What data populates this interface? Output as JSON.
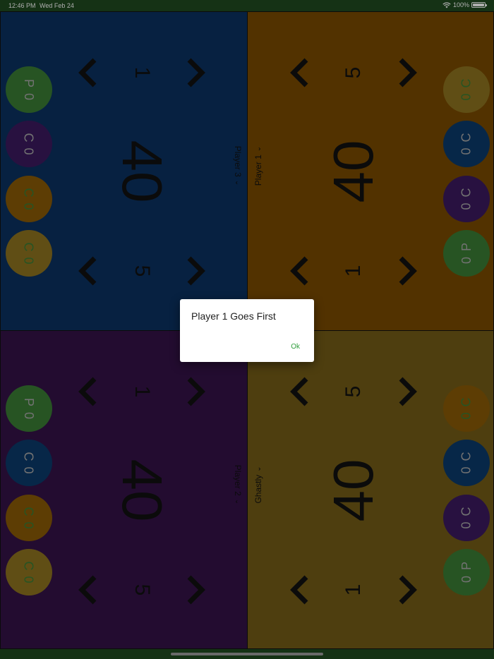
{
  "status_bar": {
    "time": "12:46 PM",
    "date": "Wed Feb 24",
    "battery": "100%"
  },
  "icons": {
    "chevron": "chevron-icon",
    "wifi": "wifi-icon",
    "battery": "battery-icon",
    "dropdown": "chevron-down-icon"
  },
  "quadrants": [
    {
      "id": "top-left",
      "color": "#0b3260",
      "player_name": "Player 3",
      "life": "40",
      "top_value": "1",
      "bottom_value": "5",
      "counters": [
        {
          "letter": "P",
          "value": "0",
          "color": "#3a7d34",
          "text_color": "#a8a8a8"
        },
        {
          "letter": "C",
          "value": "0",
          "color": "#3b1a5f",
          "text_color": "#a8a8a8"
        },
        {
          "letter": "C",
          "value": "0",
          "color": "#8a5a06",
          "text_color": "#3a7d34"
        },
        {
          "letter": "C",
          "value": "0",
          "color": "#8e7420",
          "text_color": "#3a7d34"
        }
      ]
    },
    {
      "id": "top-right",
      "color": "#7a4b00",
      "player_name": "Player 1",
      "life": "40",
      "top_value": "5",
      "bottom_value": "1",
      "counters": [
        {
          "letter": "C",
          "value": "0",
          "color": "#8e7420",
          "text_color": "#3a7d34"
        },
        {
          "letter": "C",
          "value": "0",
          "color": "#0b3a6a",
          "text_color": "#a8a8a8"
        },
        {
          "letter": "C",
          "value": "0",
          "color": "#3b1a5f",
          "text_color": "#a8a8a8"
        },
        {
          "letter": "P",
          "value": "0",
          "color": "#3a7d34",
          "text_color": "#a8a8a8"
        }
      ]
    },
    {
      "id": "bottom-left",
      "color": "#341248",
      "player_name": "Player 2",
      "life": "40",
      "top_value": "1",
      "bottom_value": "5",
      "counters": [
        {
          "letter": "P",
          "value": "0",
          "color": "#3a7d34",
          "text_color": "#a8a8a8"
        },
        {
          "letter": "C",
          "value": "0",
          "color": "#0b3a6a",
          "text_color": "#a8a8a8"
        },
        {
          "letter": "C",
          "value": "0",
          "color": "#8a5a06",
          "text_color": "#3a7d34"
        },
        {
          "letter": "C",
          "value": "0",
          "color": "#8e7420",
          "text_color": "#3a7d34"
        }
      ]
    },
    {
      "id": "bottom-right",
      "color": "#735c17",
      "player_name": "Ghastly",
      "life": "40",
      "top_value": "5",
      "bottom_value": "1",
      "counters": [
        {
          "letter": "C",
          "value": "0",
          "color": "#8a5a06",
          "text_color": "#3a7d34"
        },
        {
          "letter": "C",
          "value": "0",
          "color": "#0b3a6a",
          "text_color": "#a8a8a8"
        },
        {
          "letter": "C",
          "value": "0",
          "color": "#3b1a5f",
          "text_color": "#a8a8a8"
        },
        {
          "letter": "P",
          "value": "0",
          "color": "#3a7d34",
          "text_color": "#a8a8a8"
        }
      ]
    }
  ],
  "dialog": {
    "title": "Player 1 Goes First",
    "ok_label": "Ok"
  }
}
